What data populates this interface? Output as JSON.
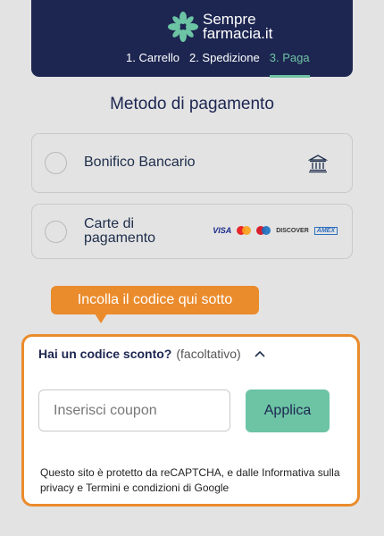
{
  "header": {
    "logo_line1": "Sempre",
    "logo_line2": "farmacia.it",
    "steps": [
      "1. Carrello",
      "2. Spedizione",
      "3. Paga"
    ],
    "active_step_index": 2
  },
  "section_title": "Metodo di pagamento",
  "payment_options": [
    {
      "label": "Bonifico Bancario",
      "icon": "bank-icon",
      "selected": false
    },
    {
      "label": "Carte di pagamento",
      "icons": [
        "visa",
        "mastercard",
        "maestro",
        "discover",
        "amex"
      ],
      "selected": false
    }
  ],
  "card_logos": {
    "visa": "VISA",
    "discover": "DISCOVER",
    "amex": "AMEX"
  },
  "tooltip": {
    "text": "Incolla il codice qui sotto"
  },
  "coupon": {
    "question": "Hai un codice sconto?",
    "optional": "(facoltativo)",
    "placeholder": "Inserisci coupon",
    "value": "",
    "apply_label": "Applica",
    "recaptcha_text": "Questo sito è protetto da reCAPTCHA, e dalle Informativa sulla privacy e Termini e condizioni di Google"
  },
  "colors": {
    "header_bg": "#1d2651",
    "accent_green": "#6cc4a4",
    "highlight_orange": "#ea8b2c",
    "background": "#e3e3e3"
  }
}
